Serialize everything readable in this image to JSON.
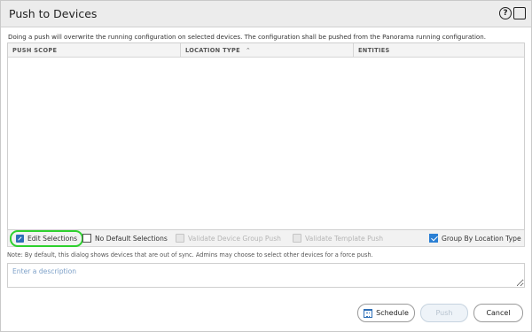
{
  "dialog": {
    "title": "Push to Devices",
    "help_icon_glyph": "?",
    "notice": "Doing a push will overwrite the running configuration on selected devices. The configuration shall be pushed from the Panorama running configuration."
  },
  "grid": {
    "columns": [
      "PUSH SCOPE",
      "LOCATION TYPE",
      "ENTITIES"
    ],
    "sorted_column": "LOCATION TYPE",
    "sort_direction": "ascending",
    "rows": []
  },
  "toolbar": {
    "edit_selections": "Edit Selections",
    "no_default_selections": "No Default Selections",
    "no_default_checked": false,
    "validate_device_group_push": "Validate Device Group Push",
    "validate_template_push": "Validate Template Push",
    "group_by_location_type": "Group By Location Type",
    "group_by_checked": true
  },
  "note": "Note: By default, this dialog shows devices that are out of sync. Admins may choose to select other devices for a force push.",
  "description": {
    "placeholder": "Enter a description",
    "value": ""
  },
  "buttons": {
    "schedule": "Schedule",
    "push": "Push",
    "push_disabled": true,
    "cancel": "Cancel"
  },
  "colors": {
    "highlight": "#2ed12e",
    "accent": "#2a7fd4",
    "disabled_text": "#b5b5b5"
  }
}
